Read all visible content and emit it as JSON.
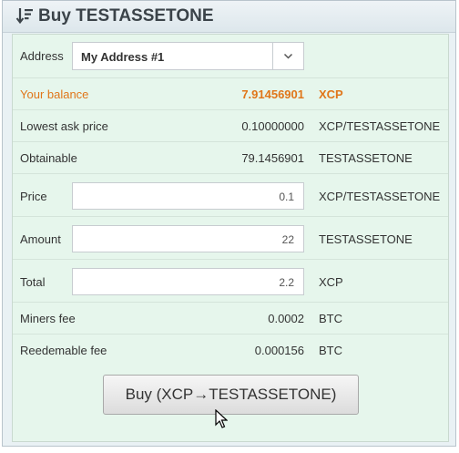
{
  "header": {
    "title": "Buy TESTASSETONE",
    "icon": "sort-descending-icon"
  },
  "form": {
    "address_label": "Address",
    "address_value": "My Address #1",
    "balance_label": "Your balance",
    "balance_value": "7.91456901",
    "balance_unit": "XCP",
    "lowest_ask_label": "Lowest ask price",
    "lowest_ask_value": "0.10000000",
    "lowest_ask_unit": "XCP/TESTASSETONE",
    "obtainable_label": "Obtainable",
    "obtainable_value": "79.1456901",
    "obtainable_unit": "TESTASSETONE",
    "price_label": "Price",
    "price_value": "0.1",
    "price_unit": "XCP/TESTASSETONE",
    "amount_label": "Amount",
    "amount_value": "22",
    "amount_unit": "TESTASSETONE",
    "total_label": "Total",
    "total_value": "2.2",
    "total_unit": "XCP",
    "miners_fee_label": "Miners fee",
    "miners_fee_value": "0.0002",
    "miners_fee_unit": "BTC",
    "redeemable_fee_label": "Reedemable fee",
    "redeemable_fee_value": "0.000156",
    "redeemable_fee_unit": "BTC"
  },
  "buy_button_label": "Buy (XCP→TESTASSETONE)",
  "colors": {
    "balance": "#e0761a",
    "panel_bg": "#e6f6ec"
  }
}
